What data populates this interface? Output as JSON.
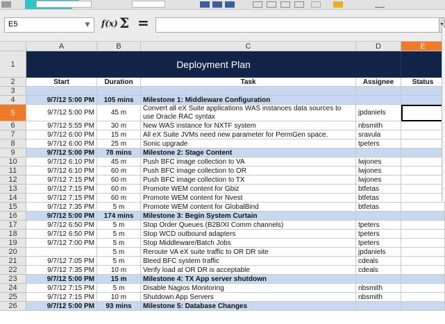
{
  "formula_bar": {
    "cell_ref": "E5",
    "formula_value": ""
  },
  "columns": [
    "A",
    "B",
    "C",
    "D",
    "E"
  ],
  "selected": {
    "column": "E",
    "row": "5"
  },
  "colors": {
    "title_bg": "#0f2447",
    "milestone_bg": "#c6d9f1",
    "selection": "#f07a2a"
  },
  "rows": [
    {
      "n": "1",
      "type": "title",
      "title": "Deployment Plan"
    },
    {
      "n": "2",
      "type": "header",
      "start": "Start",
      "duration": "Duration",
      "task": "Task",
      "assignee": "Assignee",
      "status": "Status"
    },
    {
      "n": "3",
      "type": "blank"
    },
    {
      "n": "4",
      "type": "milestone",
      "start": "9/7/12 5:00 PM",
      "duration": "105 mins",
      "task": "Milestone 1: Middleware Configuration"
    },
    {
      "n": "5",
      "type": "task",
      "start": "9/7/12 5:00 PM",
      "duration": "45 m",
      "task": "Convert all eX Suite applications WAS instances data sources to use Oracle RAC syntax",
      "assignee": "jpdaniels"
    },
    {
      "n": "6",
      "type": "task",
      "start": "9/7/12 5:55 PM",
      "duration": "30 m",
      "task": "New WAS instance for NXTF system",
      "assignee": "nbsmith"
    },
    {
      "n": "7",
      "type": "task",
      "start": "9/7/12 6:00 PM",
      "duration": "15 m",
      "task": "All eX Suite JVMs need new parameter for PermGen space.",
      "assignee": "sravula"
    },
    {
      "n": "8",
      "type": "task",
      "start": "9/7/12 6:00 PM",
      "duration": "25 m",
      "task": "Sonic upgrade",
      "assignee": "tpeters"
    },
    {
      "n": "9",
      "type": "milestone",
      "start": "9/7/12 5:00 PM",
      "duration": "78 mins",
      "task": "Milestone 2: Stage Content"
    },
    {
      "n": "10",
      "type": "task",
      "start": "9/7/12 6:10 PM",
      "duration": "45 m",
      "task": "Push BFC image collection to VA",
      "assignee": "lwjones"
    },
    {
      "n": "11",
      "type": "task",
      "start": "9/7/12 6:10 PM",
      "duration": "60 m",
      "task": "Push BFC image collection to OR",
      "assignee": "lwjones"
    },
    {
      "n": "12",
      "type": "task",
      "start": "9/7/12 7:15 PM",
      "duration": "60 m",
      "task": "Push BFC image collection to TX",
      "assignee": "lwjones"
    },
    {
      "n": "13",
      "type": "task",
      "start": "9/7/12 7:15 PM",
      "duration": "60 m",
      "task": "Promote WEM content for Gbiz",
      "assignee": "btfetas"
    },
    {
      "n": "14",
      "type": "task",
      "start": "9/7/12 7:15 PM",
      "duration": "60 m",
      "task": "Promote WEM content for Nvest",
      "assignee": "btfetas"
    },
    {
      "n": "15",
      "type": "task",
      "start": "9/7/12 7:35 PM",
      "duration": "5 m",
      "task": "Promote WEM content for GlobalBind",
      "assignee": "btfetas"
    },
    {
      "n": "16",
      "type": "milestone",
      "start": "9/7/12 5:00 PM",
      "duration": "174 mins",
      "task": "Milestone 3: Begin System Curtain"
    },
    {
      "n": "17",
      "type": "task",
      "start": "9/7/12 6:50 PM",
      "duration": "5 m",
      "task": "Stop Order Queues (B2B/XI Comm channels)",
      "assignee": "tpeters"
    },
    {
      "n": "18",
      "type": "task",
      "start": "9/7/12 6:50 PM",
      "duration": "5 m",
      "task": "Stop WCD outbound adapters",
      "assignee": "tpeters"
    },
    {
      "n": "19",
      "type": "task",
      "start": "9/7/12 7:00 PM",
      "duration": "5 m",
      "task": "Stop Middleware/Batch Jobs",
      "assignee": "tpeters"
    },
    {
      "n": "20",
      "type": "task",
      "start": "",
      "duration": "5 m",
      "task": "Reroute VA eX suite traffic to OR DR site",
      "assignee": "jpdaniels"
    },
    {
      "n": "21",
      "type": "task",
      "start": "9/7/12 7:05 PM",
      "duration": "5 m",
      "task": "Bleed BFC system traffic",
      "assignee": "cdeals"
    },
    {
      "n": "22",
      "type": "task",
      "start": "9/7/12 7:35 PM",
      "duration": "10 m",
      "task": "Verify load at OR DR is acceptable",
      "assignee": "cdeals"
    },
    {
      "n": "23",
      "type": "milestone",
      "start": "9/7/12 5:00 PM",
      "duration": "15 m",
      "task": "Milestone 4: TX App server shutdown"
    },
    {
      "n": "24",
      "type": "task",
      "start": "9/7/12 7:15 PM",
      "duration": "5 m",
      "task": "Disable Nagios Monitoring",
      "assignee": "nbsmith"
    },
    {
      "n": "25",
      "type": "task",
      "start": "9/7/12 7:15 PM",
      "duration": "10 m",
      "task": "Shutdown App Servers",
      "assignee": "nbsmith"
    },
    {
      "n": "26",
      "type": "milestone",
      "start": "9/7/12 5:00 PM",
      "duration": "93 mins",
      "task": "Milestone 5: Database Changes"
    }
  ]
}
